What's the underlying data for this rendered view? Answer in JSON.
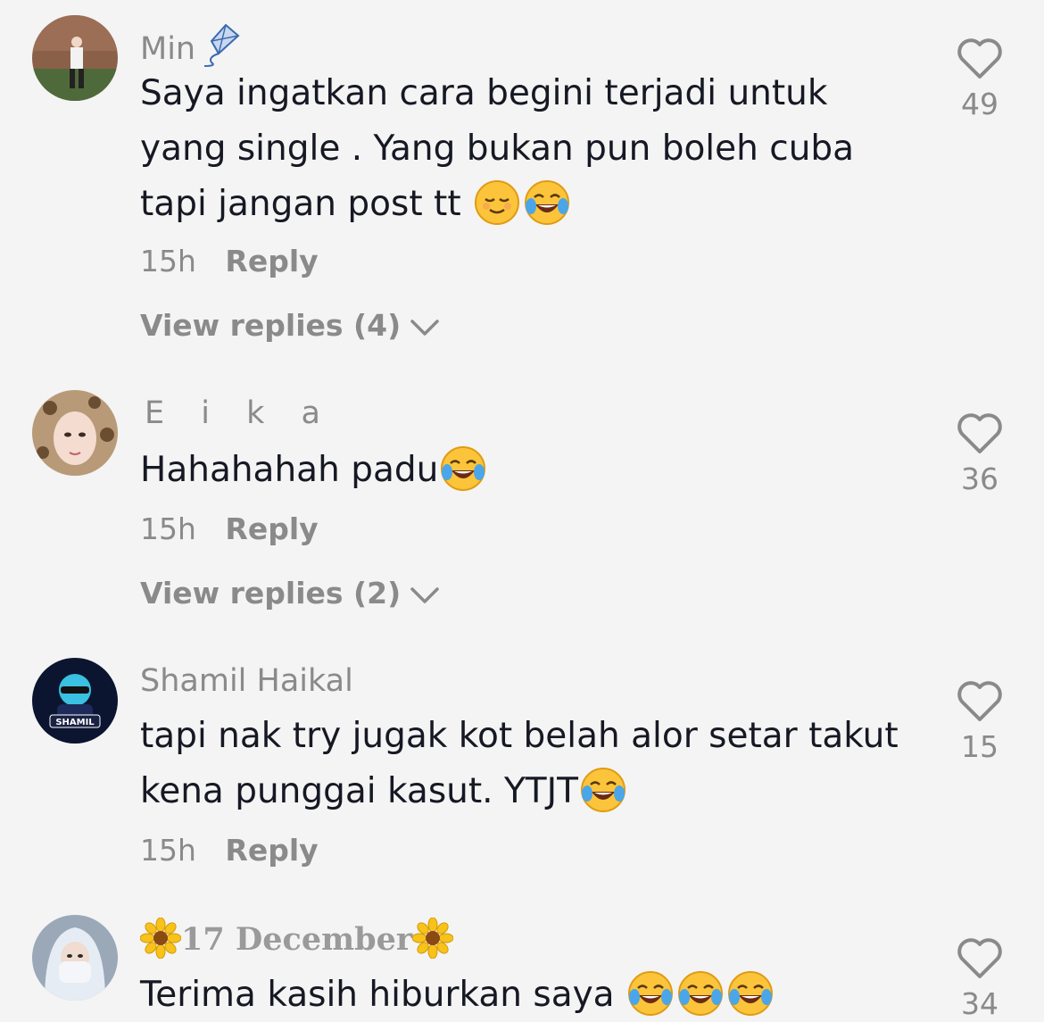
{
  "comments": [
    {
      "username": "Min",
      "username_icon": "kite-icon",
      "lines": [
        "Saya ingatkan cara begini terjadi untuk",
        "yang single . Yang bukan pun boleh cuba",
        "tapi jangan post tt"
      ],
      "trailing_emojis": [
        "relieved-face-emoji",
        "tears-of-joy-emoji"
      ],
      "time": "15h",
      "reply_label": "Reply",
      "view_replies": "View replies (4)",
      "likes": "49"
    },
    {
      "username": "E i k a",
      "lines": [
        "Hahahahah padu"
      ],
      "trailing_emojis": [
        "tears-of-joy-emoji"
      ],
      "time": "15h",
      "reply_label": "Reply",
      "view_replies": "View replies (2)",
      "likes": "36"
    },
    {
      "username": "Shamil Haikal",
      "lines": [
        "tapi nak try jugak kot belah alor setar takut",
        "kena punggai kasut. YTJT"
      ],
      "trailing_emojis": [
        "tears-of-joy-emoji"
      ],
      "time": "15h",
      "reply_label": "Reply",
      "likes": "15"
    },
    {
      "username": "17 December",
      "username_icons": [
        "sunflower-icon",
        "sunflower-icon"
      ],
      "lines": [
        "Terima kasih hiburkan saya"
      ],
      "trailing_emojis": [
        "tears-of-joy-emoji",
        "tears-of-joy-emoji",
        "tears-of-joy-emoji"
      ],
      "likes": "34"
    }
  ],
  "colors": {
    "background": "#f4f4f4",
    "text": "#161823",
    "secondary": "#8a8a8a"
  }
}
